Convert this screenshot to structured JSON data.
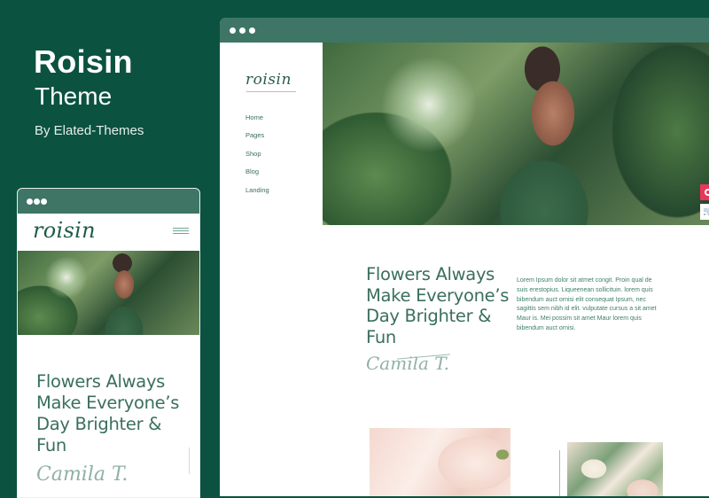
{
  "brand": {
    "title": "Roisin",
    "subtitle": "Theme",
    "byline": "By Elated-Themes"
  },
  "desktop": {
    "logo": "roisin",
    "nav": [
      "Home",
      "Pages",
      "Shop",
      "Blog",
      "Landing"
    ],
    "headline": "Flowers Always Make Everyone’s Day Brighter & Fun",
    "signature": "Camila T.",
    "paragraph": "Lorem Ipsum dolor sit atmet congit. Proin qual de suis erestopius. Liqueenean sollicituin. lorem quis bibendum auct ornisi elit consequat Ipsum, nec sagittis sem nibh id elit. vulputate cursus a sit amet Maur is. Mei possim sit amet Maur lorem quis bibendum auct ornisi.",
    "cart_icon": "🛒"
  },
  "mobile": {
    "logo": "roisin",
    "headline": "Flowers Always Make Everyone’s Day Brighter & Fun",
    "signature": "Camila T."
  },
  "colors": {
    "background": "#0b5240",
    "window_bar": "#3e7565",
    "accent_text": "#3a6f5f",
    "float_button": "#e8385a"
  }
}
